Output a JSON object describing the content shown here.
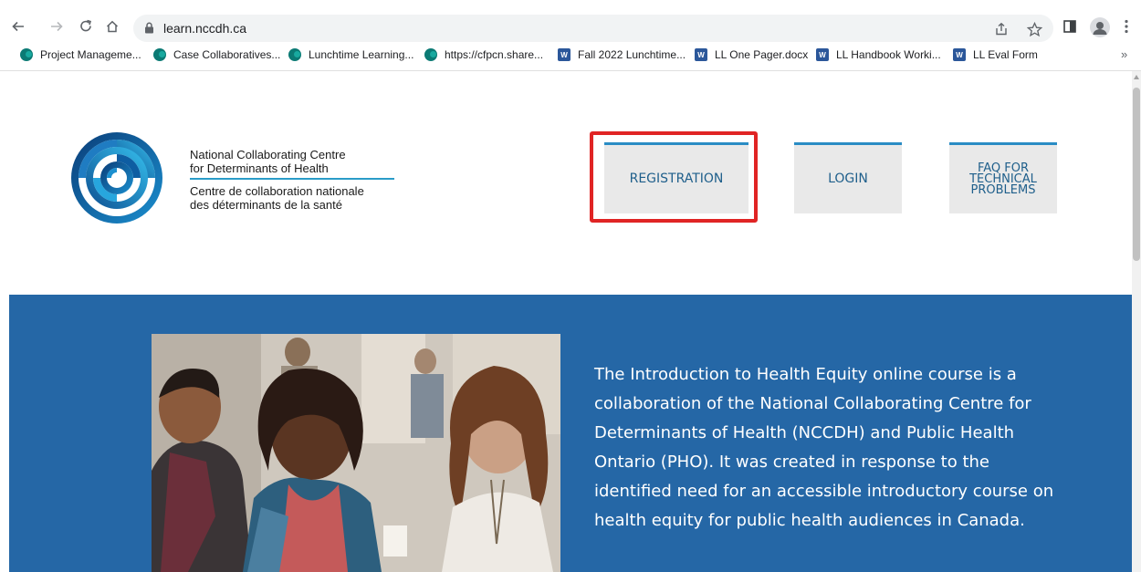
{
  "browser": {
    "url": "learn.nccdh.ca",
    "bookmarks": [
      {
        "label": "Project Manageme...",
        "icon": "sharepoint-icon"
      },
      {
        "label": "Case Collaboratives...",
        "icon": "sharepoint-icon"
      },
      {
        "label": "Lunchtime Learning...",
        "icon": "sharepoint-icon"
      },
      {
        "label": "https://cfpcn.share...",
        "icon": "sharepoint-icon"
      },
      {
        "label": "Fall 2022 Lunchtime...",
        "icon": "word-icon"
      },
      {
        "label": "LL One Pager.docx",
        "icon": "word-icon"
      },
      {
        "label": "LL Handbook Worki...",
        "icon": "word-icon"
      },
      {
        "label": "LL Eval Form",
        "icon": "word-icon"
      }
    ],
    "more_label": "»"
  },
  "header": {
    "logo_lines_en": [
      "National Collaborating Centre",
      "for Determinants of Health"
    ],
    "logo_lines_fr": [
      "Centre de collaboration nationale",
      "des déterminants de la santé"
    ],
    "nav": {
      "registration": "REGISTRATION",
      "login": "LOGIN",
      "faq": [
        "FAQ FOR",
        "TECHNICAL",
        "PROBLEMS"
      ]
    }
  },
  "hero": {
    "text": "The Introduction to Health Equity online course is a collaboration of the National Collaborating Centre for Determinants of Health (NCCDH) and Public Health Ontario (PHO). It was created in response to the identified need for an accessible introductory course on health equity for public health audiences in Canada."
  },
  "colors": {
    "hero_bg": "#2567a6",
    "nav_accent": "#2a8cc4",
    "highlight": "#e02424",
    "logo_rule": "#2a9cc8"
  }
}
